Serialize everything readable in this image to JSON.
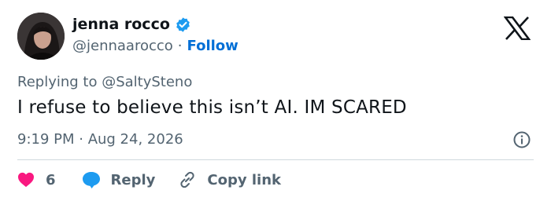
{
  "author": {
    "name": "jenna rocco",
    "handle": "@jennaarocco",
    "separator": "·",
    "follow_label": "Follow",
    "verified": true
  },
  "reply_to": "Replying to @SaltySteno",
  "tweet_text": "I refuse to believe this isn’t AI. IM SCARED",
  "timestamp": "9:19 PM · Aug 24, 2026",
  "actions": {
    "like_count": "6",
    "reply_label": "Reply",
    "copy_link_label": "Copy link"
  },
  "colors": {
    "like": "#f91880",
    "reply": "#1d9bf0",
    "follow": "#006fd6",
    "verified": "#1d9bf0",
    "secondary_text": "#536471"
  },
  "icons": [
    "avatar",
    "verified-badge-icon",
    "x-logo-icon",
    "info-icon",
    "heart-icon",
    "reply-bubble-icon",
    "link-icon"
  ]
}
